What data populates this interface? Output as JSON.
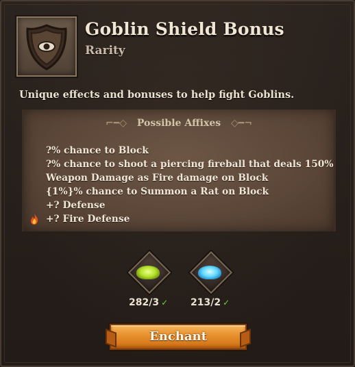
{
  "item": {
    "title": "Goblin Shield Bonus",
    "subtitle": "Rarity",
    "icon": "goblin-shield-icon",
    "description": "Unique effects and bonuses to help fight Goblins."
  },
  "affixes": {
    "header": "Possible Affixes",
    "items": [
      "?% chance to Block",
      "?% chance to shoot a piercing fireball that deals 150%",
      "Weapon Damage as Fire damage on Block",
      "{1%}% chance to Summon a Rat on Block",
      "+? Defense",
      "+? Fire Defense"
    ]
  },
  "materials": [
    {
      "name": "green-dust-icon",
      "count": "282/3",
      "color": "#b6e22a",
      "sufficient": true
    },
    {
      "name": "blue-dust-icon",
      "count": "213/2",
      "color": "#5fd8ff",
      "sufficient": true
    }
  ],
  "colors": {
    "panel": "#2b231e",
    "parchment": "#5b4638",
    "button": "#e68f2c",
    "check": "#6bd23a"
  },
  "actions": {
    "enchant_label": "Enchant"
  }
}
